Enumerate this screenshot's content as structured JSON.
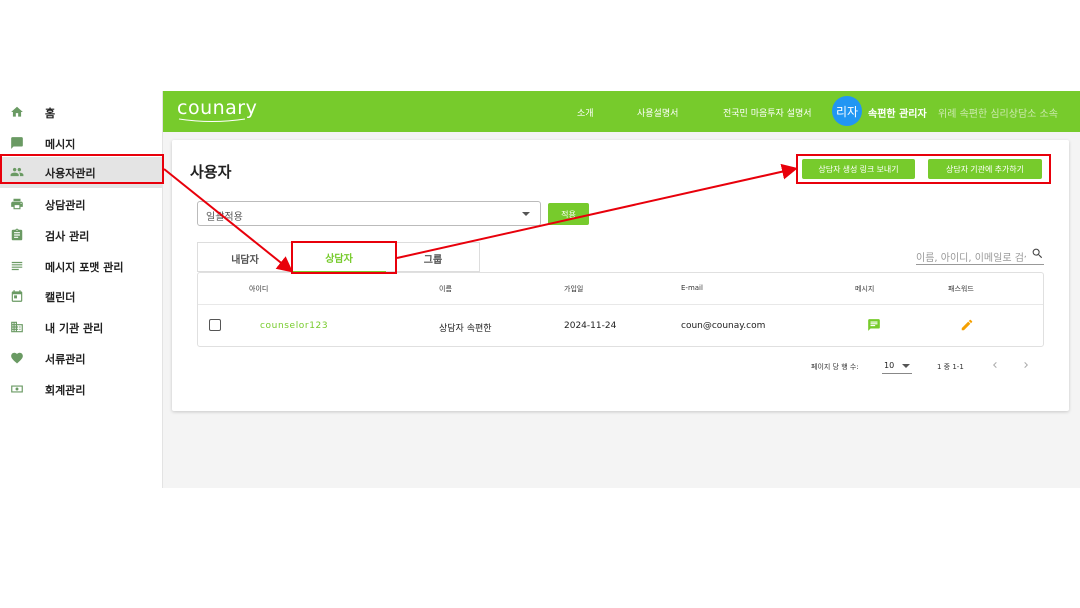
{
  "sidebar": {
    "items": [
      {
        "label": "홈",
        "icon": "home-icon"
      },
      {
        "label": "메시지",
        "icon": "message-icon"
      },
      {
        "label": "사용자관리",
        "icon": "people-icon",
        "active": true
      },
      {
        "label": "상담관리",
        "icon": "print-icon"
      },
      {
        "label": "검사 관리",
        "icon": "clipboard-icon"
      },
      {
        "label": "메시지 포맷 관리",
        "icon": "lines-icon"
      },
      {
        "label": "캘린더",
        "icon": "calendar-icon"
      },
      {
        "label": "내 기관 관리",
        "icon": "building-icon"
      },
      {
        "label": "서류관리",
        "icon": "heart-icon"
      },
      {
        "label": "회계관리",
        "icon": "money-icon"
      }
    ]
  },
  "header": {
    "logo": "counary",
    "nav": [
      "소개",
      "사용설명서",
      "전국민 마음투자 설명서"
    ],
    "avatar_text": "리자",
    "user_name": "속편한 관리자",
    "user_affiliation": "위례 속편한 심리상담소 소속"
  },
  "page": {
    "title": "사용자",
    "buttons": {
      "send_link": "상담자 생성 링크 보내기",
      "add_to_org": "상담자 기관에 추가하기",
      "apply": "적용"
    },
    "bulk_select": {
      "value": "일괄적용"
    },
    "tabs": [
      "내담자",
      "상담자",
      "그룹"
    ],
    "active_tab": "상담자",
    "search": {
      "placeholder": "이름, 아이디, 이메일로 검색"
    }
  },
  "table": {
    "columns": [
      "아이디",
      "이름",
      "가입일",
      "E-mail",
      "메시지",
      "패스워드"
    ],
    "rows": [
      {
        "id": "counselor123",
        "name": "상담자 속편한",
        "joined": "2024-11-24",
        "email": "coun@counay.com"
      }
    ]
  },
  "pagination": {
    "rows_per_page_label": "페이지 당 행 수:",
    "rows_per_page": "10",
    "range": "1 중 1-1"
  },
  "colors": {
    "brand_green": "#77cb2c",
    "avatar_blue": "#2196f3",
    "highlight_red": "#e8000b",
    "edit_orange": "#f5a000"
  }
}
